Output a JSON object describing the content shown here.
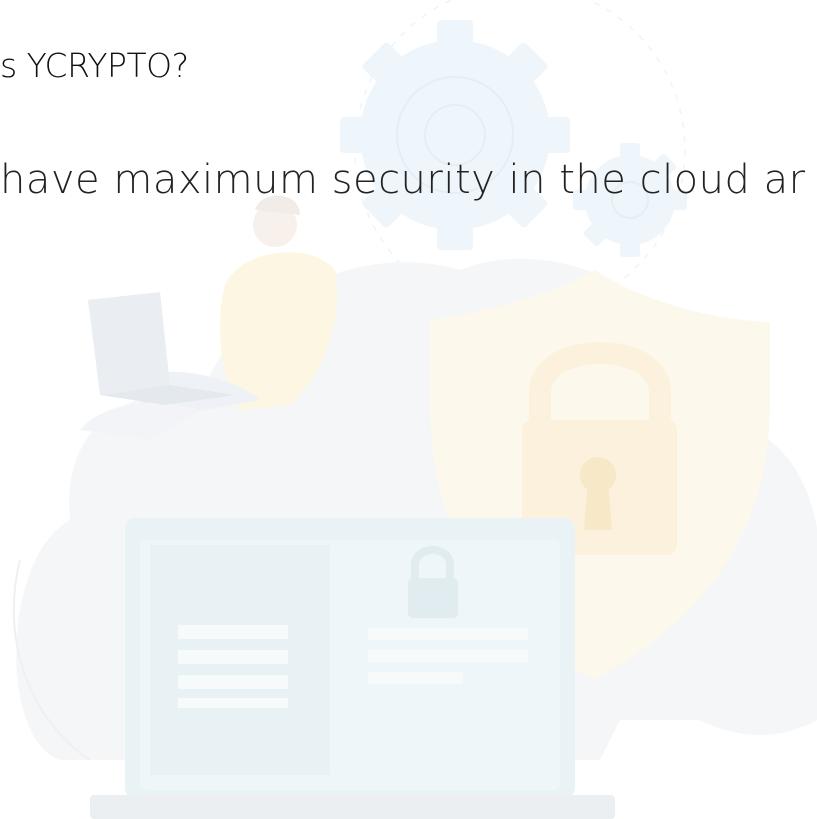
{
  "heading": {
    "text": "s YCRYPTO?"
  },
  "subtext": {
    "text": "have maximum security in the cloud ar"
  },
  "illustration": {
    "description_icons": [
      "cloud-icon",
      "gear-icon",
      "shield-icon",
      "padlock-icon",
      "laptop-icon",
      "person-icon"
    ],
    "colors": {
      "cloud": "#f4f6f8",
      "gear": "#eef6fb",
      "shield": "#fdf8ec",
      "padlock": "#fbf1dc",
      "laptop_screen": "#eef6f9",
      "person_shirt": "#fdf6e3"
    }
  }
}
